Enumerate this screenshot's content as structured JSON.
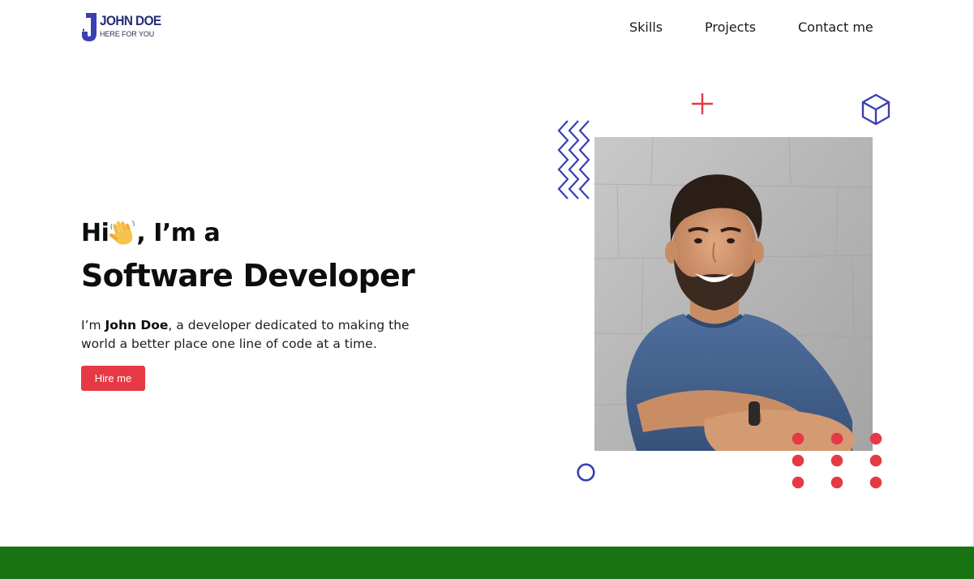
{
  "brand": {
    "name": "JOHN DOE",
    "tagline": "HERE FOR YOU",
    "colors": {
      "navy": "#262b78",
      "blue": "#3a3fb5"
    }
  },
  "nav": {
    "items": [
      {
        "label": "Skills"
      },
      {
        "label": "Projects"
      },
      {
        "label": "Contact me"
      }
    ]
  },
  "hero": {
    "greeting_prefix": "Hi",
    "greeting_icon": "waving-hand-icon",
    "greeting_suffix": ", I’m a",
    "role": "Software Developer",
    "intro_prefix": "I’m ",
    "intro_name": "John Doe",
    "intro_rest": ", a developer dedicated to making the world a better place one line of code at a time.",
    "cta_label": "Hire me"
  },
  "decorations": {
    "icons": [
      "zigzag-lines-icon",
      "plus-icon",
      "cube-icon",
      "circle-outline-icon",
      "dot-grid-icon"
    ],
    "portrait": "portrait-photo"
  },
  "colors": {
    "accent_red": "#e63946",
    "decor_blue": "#3a3fb5",
    "footer_green": "#187413",
    "text": "#0d0d0d"
  }
}
